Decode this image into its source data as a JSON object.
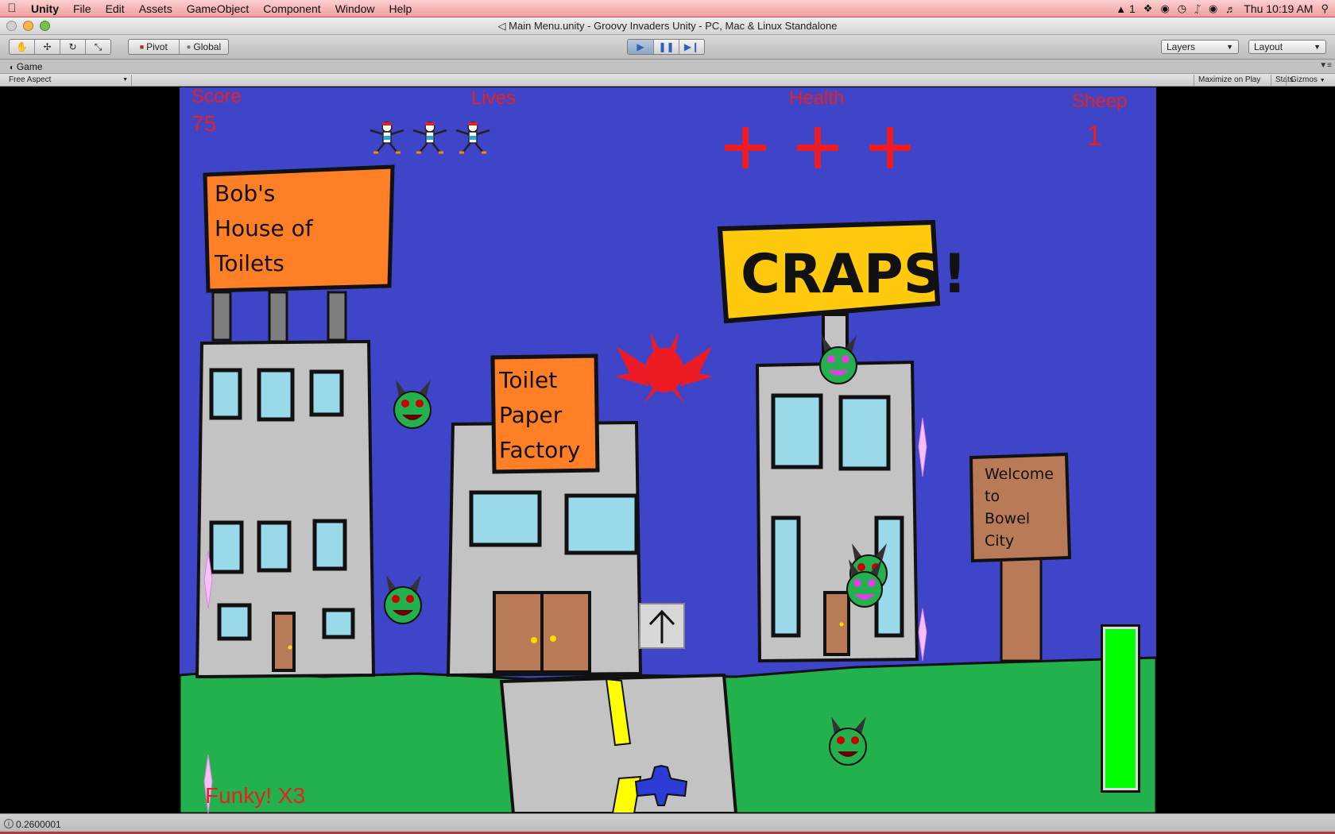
{
  "menubar": {
    "app_name": "Unity",
    "items": [
      "File",
      "Edit",
      "Assets",
      "GameObject",
      "Component",
      "Window",
      "Help"
    ],
    "status_badge": "1",
    "clock": "Thu 10:19 AM"
  },
  "window": {
    "title": "Main Menu.unity - Groovy Invaders Unity - PC, Mac & Linux Standalone"
  },
  "toolbar": {
    "pivot_label": "Pivot",
    "global_label": "Global",
    "layers_label": "Layers",
    "layout_label": "Layout"
  },
  "game_tab": {
    "title": "Game",
    "aspect": "Free Aspect",
    "maximize_label": "Maximize on Play",
    "stats_label": "Stats",
    "gizmos_label": "Gizmos"
  },
  "hud": {
    "score_label": "Score",
    "score_value": "75",
    "lives_label": "Lives",
    "lives_count": 3,
    "health_label": "Health",
    "health_count": 3,
    "sheep_label": "Sheep",
    "sheep_value": "1",
    "combo_text": "Funky! X3",
    "power_level": 1.0
  },
  "signs": {
    "bobs": [
      "Bob's",
      "House of",
      "Toilets"
    ],
    "craps": "CRAPS!",
    "factory": [
      "Toilet",
      "Paper",
      "Factory"
    ],
    "welcome": [
      "Welcome",
      "to",
      "Bowel",
      "City"
    ]
  },
  "statusbar": {
    "message": "0.2600001"
  },
  "colors": {
    "sky": "#3e45c9",
    "grass": "#22b14c",
    "hud_red": "#e8201f",
    "sign_orange": "#ff7f27",
    "sign_yellow": "#ffc90e",
    "sign_brown": "#b97a57",
    "building_gray": "#c3c3c3",
    "window_blue": "#99d9ea",
    "power_green": "#00ff00",
    "menubar_pink": "#f19d9d"
  }
}
